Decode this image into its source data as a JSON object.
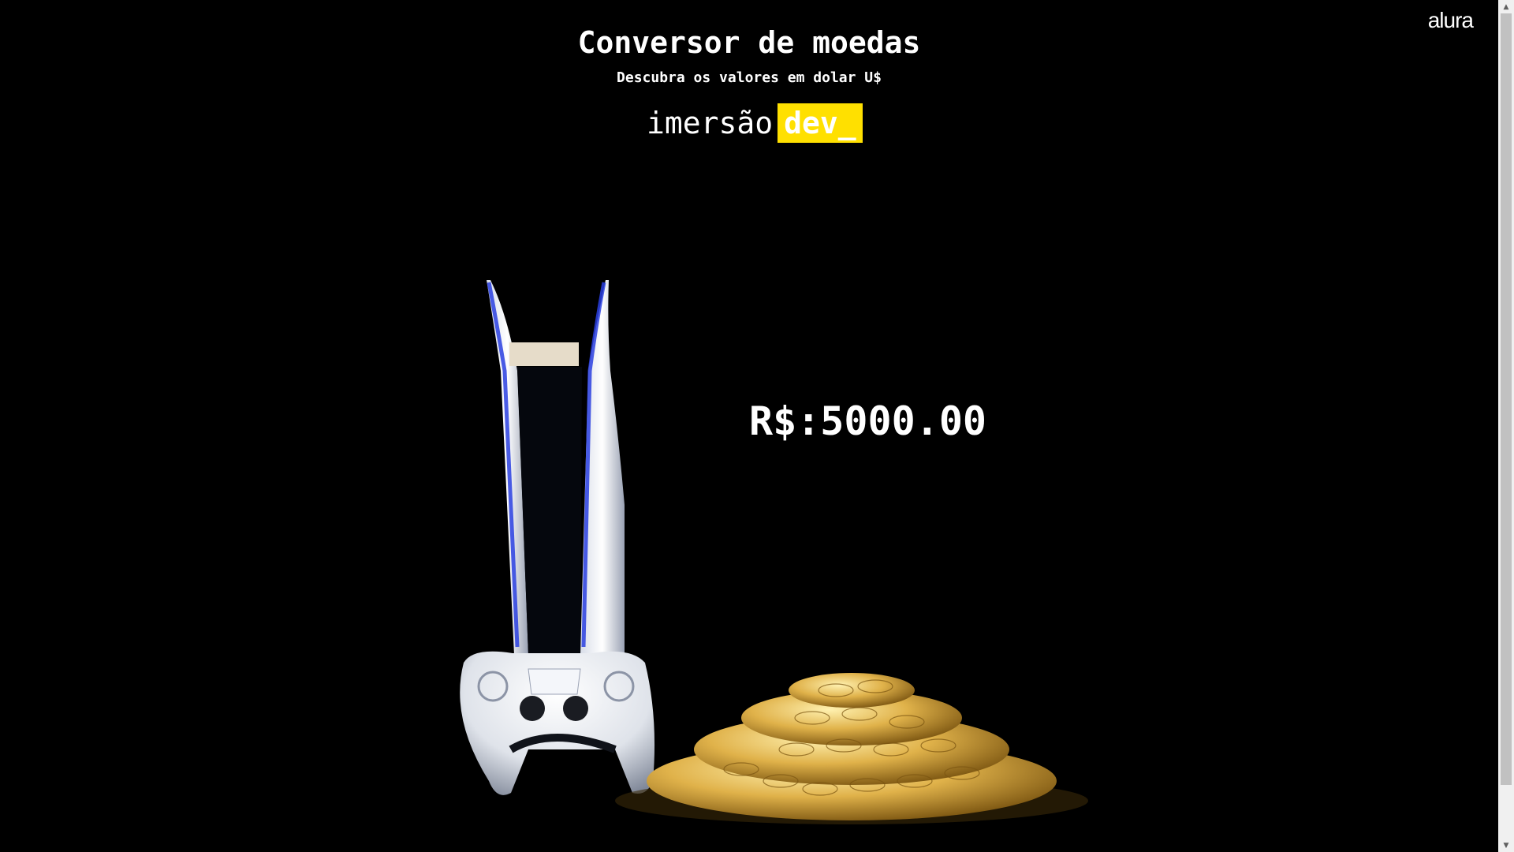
{
  "header": {
    "brand": "alura",
    "title": "Conversor de moedas",
    "subtitle": "Descubra os valores em dolar U$"
  },
  "logo": {
    "word": "imersão",
    "highlight": "dev_"
  },
  "main": {
    "price": "R$:5000.00"
  },
  "colors": {
    "background": "#000000",
    "text": "#ffffff",
    "accent": "#ffe000"
  },
  "scrollbar": {
    "up_icon": "▲",
    "down_icon": "▼"
  }
}
